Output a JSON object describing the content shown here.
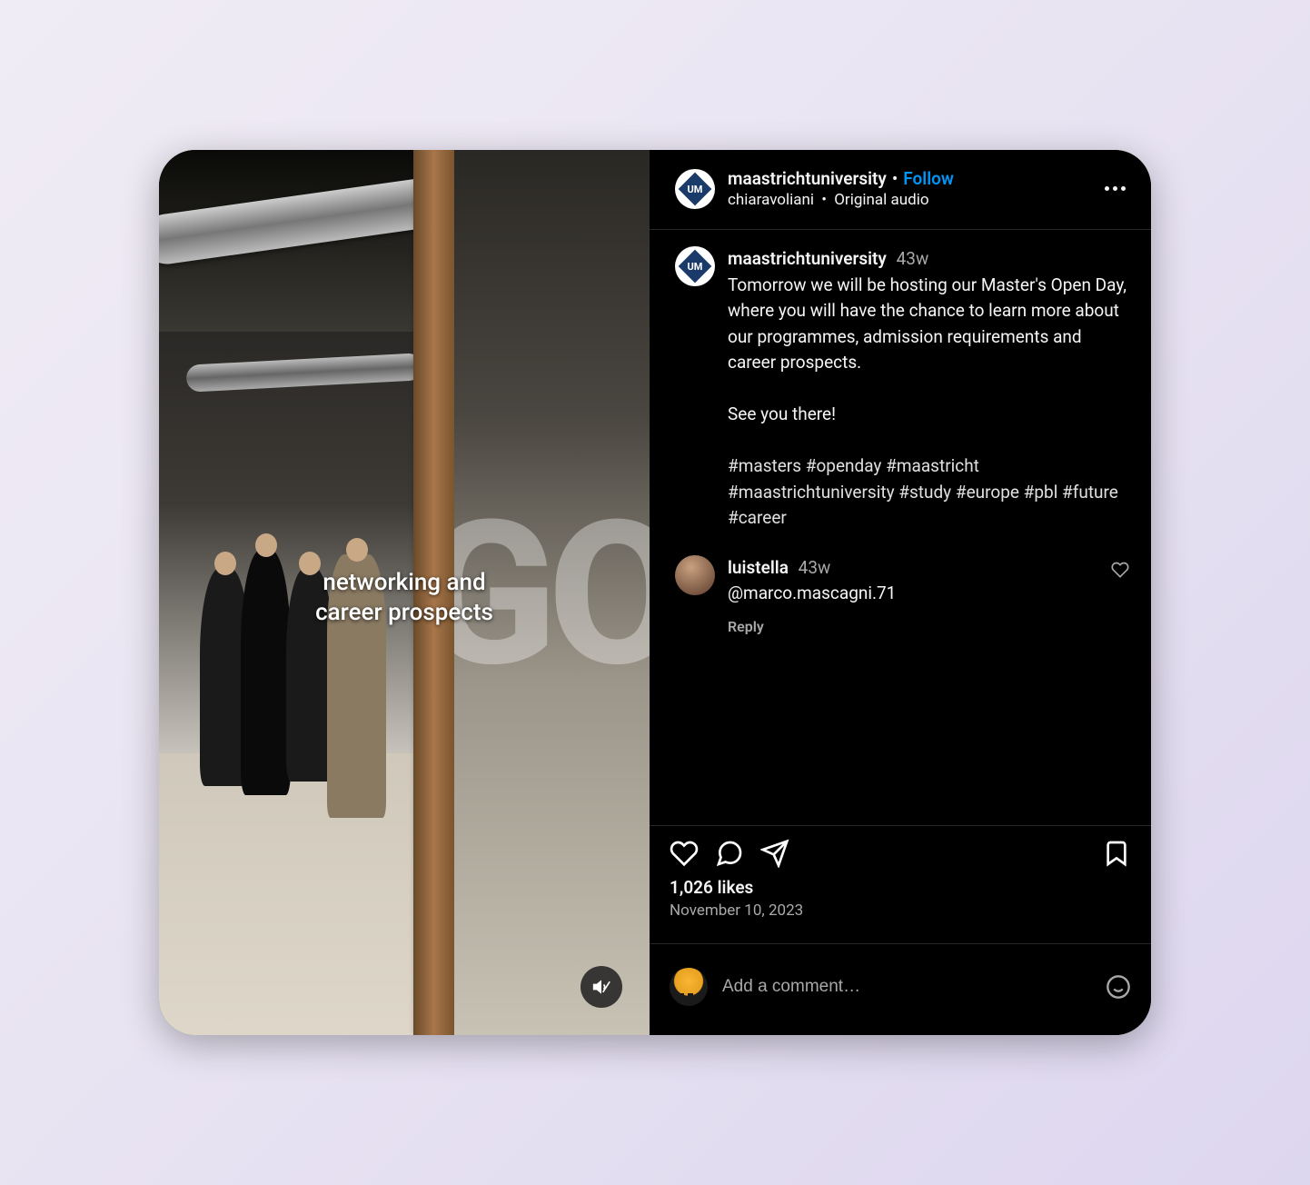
{
  "video": {
    "caption_line1": "networking and",
    "caption_line2": "career prospects",
    "glass_text": "GO"
  },
  "header": {
    "username": "maastrichtuniversity",
    "follow_label": "Follow",
    "audio_author": "chiaravoliani",
    "audio_label": "Original audio"
  },
  "caption": {
    "username": "maastrichtuniversity",
    "time": "43w",
    "body": "Tomorrow we will be hosting our Master's Open Day, where you will have the chance to learn more about our programmes, admission requirements and career prospects.",
    "line2": "See you there!",
    "hashtags": "#masters #openday #maastricht #maastrichtuniversity #study #europe #pbl #future #career"
  },
  "comments": [
    {
      "username": "luistella",
      "time": "43w",
      "text": "@marco.mascagni.71",
      "reply_label": "Reply"
    }
  ],
  "actions": {
    "likes_text": "1,026 likes",
    "date_text": "November 10, 2023"
  },
  "composer": {
    "placeholder": "Add a comment…"
  }
}
